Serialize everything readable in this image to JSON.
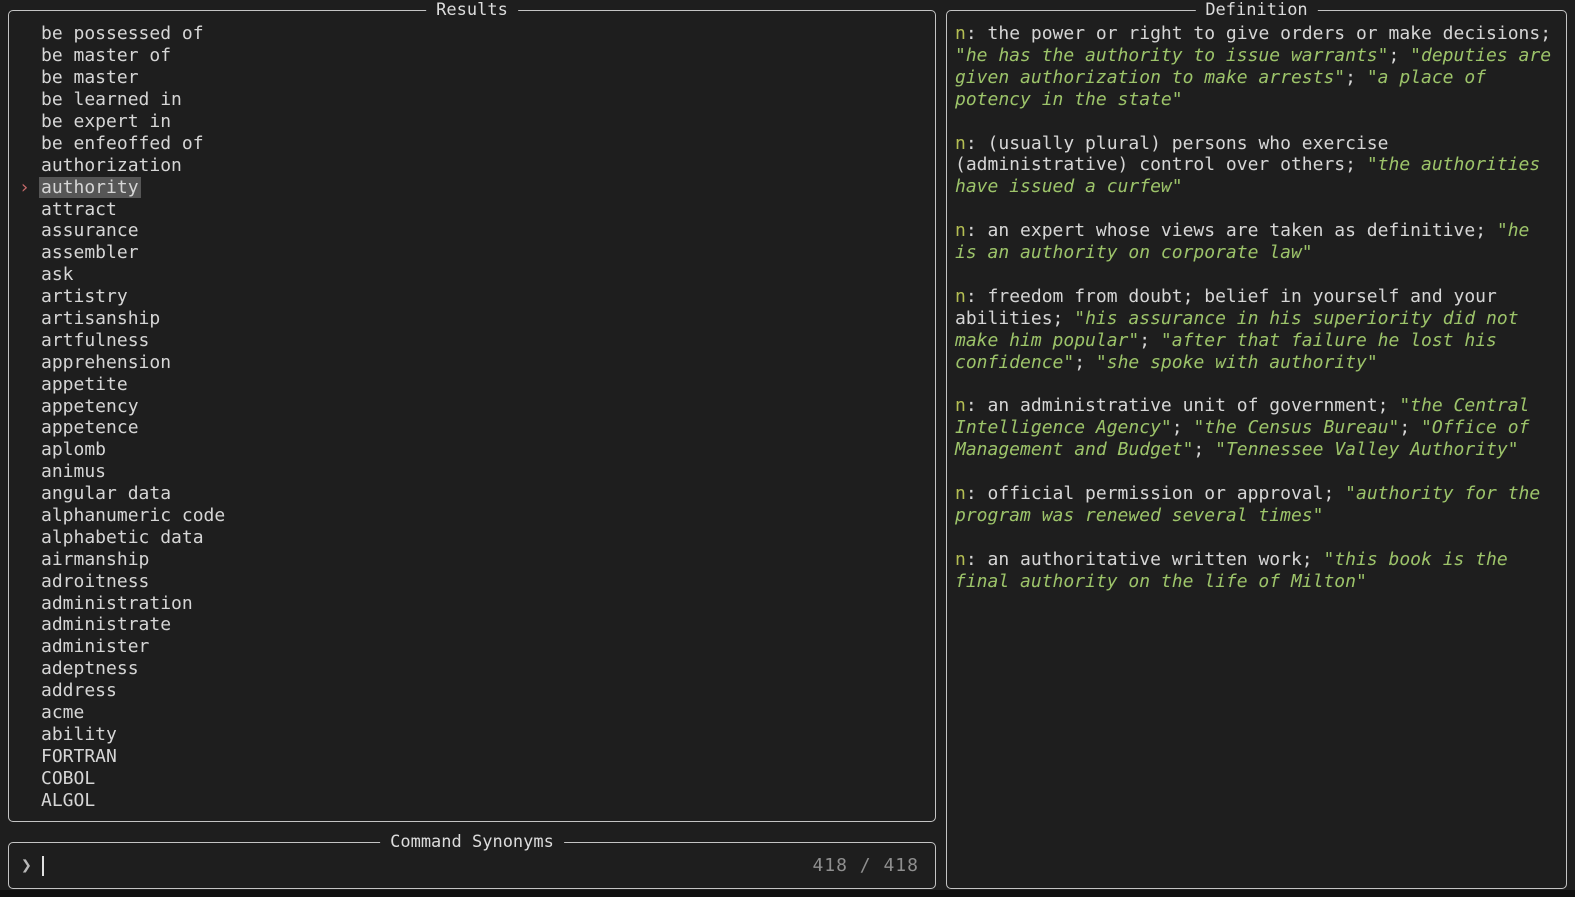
{
  "colors": {
    "background": "#1e1e1e",
    "panel_border": "#c4c4c4",
    "text": "#d6d6d6",
    "pos_tag": "#b4be53",
    "example_quote": "#9dc46a",
    "pointer": "#c66a6a",
    "selection_bg": "#565656",
    "counter": "#8f8f8f"
  },
  "results_panel": {
    "title": "Results",
    "pointer_symbol": "›",
    "selected_index": 7,
    "items": [
      "be possessed of",
      "be master of",
      "be master",
      "be learned in",
      "be expert in",
      "be enfeoffed of",
      "authorization",
      "authority",
      "attract",
      "assurance",
      "assembler",
      "ask",
      "artistry",
      "artisanship",
      "artfulness",
      "apprehension",
      "appetite",
      "appetency",
      "appetence",
      "aplomb",
      "animus",
      "angular data",
      "alphanumeric code",
      "alphabetic data",
      "airmanship",
      "adroitness",
      "administration",
      "administrate",
      "administer",
      "adeptness",
      "address",
      "acme",
      "ability",
      "FORTRAN",
      "COBOL",
      "ALGOL"
    ]
  },
  "definition_panel": {
    "title": "Definition",
    "entries": [
      {
        "pos": "n",
        "gloss": "the power or right to give orders or make decisions",
        "examples": [
          "he has the authority to issue warrants",
          "deputies are given authorization to make arrests",
          "a place of potency in the state"
        ]
      },
      {
        "pos": "n",
        "gloss": "(usually plural) persons who exercise (administrative) control over others",
        "examples": [
          "the authorities have issued a curfew"
        ]
      },
      {
        "pos": "n",
        "gloss": "an expert whose views are taken as definitive",
        "examples": [
          "he is an authority on corporate law"
        ]
      },
      {
        "pos": "n",
        "gloss": "freedom from doubt; belief in yourself and your abilities",
        "examples": [
          "his assurance in his superiority did not make him popular",
          "after that failure he lost his confidence",
          "she spoke with authority"
        ]
      },
      {
        "pos": "n",
        "gloss": "an administrative unit of government",
        "examples": [
          "the Central Intelligence Agency",
          "the Census Bureau",
          "Office of Management and Budget",
          "Tennessee Valley Authority"
        ]
      },
      {
        "pos": "n",
        "gloss": "official permission or approval",
        "examples": [
          "authority for the program was renewed several times"
        ]
      },
      {
        "pos": "n",
        "gloss": "an authoritative written work",
        "examples": [
          "this book is the final authority on the life of Milton"
        ]
      }
    ]
  },
  "command_panel": {
    "title": "Command Synonyms",
    "prompt_symbol": "❯",
    "input_value": "",
    "counter": "418 / 418"
  }
}
